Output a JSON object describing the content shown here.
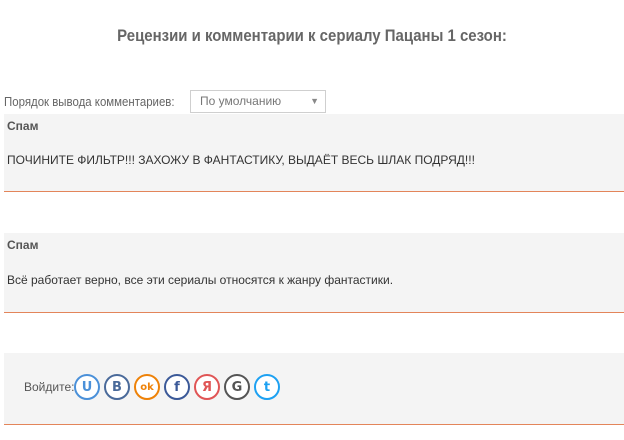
{
  "page": {
    "title": "Рецензии и комментарии к сериалу Пацаны 1 сезон:"
  },
  "sort": {
    "label": "Порядок вывода комментариев:",
    "selected": "По умолчанию"
  },
  "comments": [
    {
      "author": "Спам",
      "text": "ПОЧИНИТЕ ФИЛЬТР!!! ЗАХОЖУ В ФАНТАСТИКУ, ВЫДАЁТ ВЕСЬ ШЛАК ПОДРЯД!!!"
    },
    {
      "author": "Спам",
      "text": "Всё работает верно, все эти сериалы относятся к жанру фантастики."
    }
  ],
  "login": {
    "label": "Войдите:",
    "providers": [
      {
        "name": "u-icon",
        "glyph": "U",
        "color": "#4a90d9"
      },
      {
        "name": "vk-icon",
        "glyph": "B",
        "color": "#4a6a9a"
      },
      {
        "name": "odnoklassniki-icon",
        "glyph": "ok",
        "color": "#ee8208"
      },
      {
        "name": "facebook-icon",
        "glyph": "f",
        "color": "#3b5998"
      },
      {
        "name": "yandex-icon",
        "glyph": "Я",
        "color": "#e05555"
      },
      {
        "name": "google-icon",
        "glyph": "G",
        "color": "#555555"
      },
      {
        "name": "twitter-icon",
        "glyph": "t",
        "color": "#1da1f2"
      }
    ]
  }
}
